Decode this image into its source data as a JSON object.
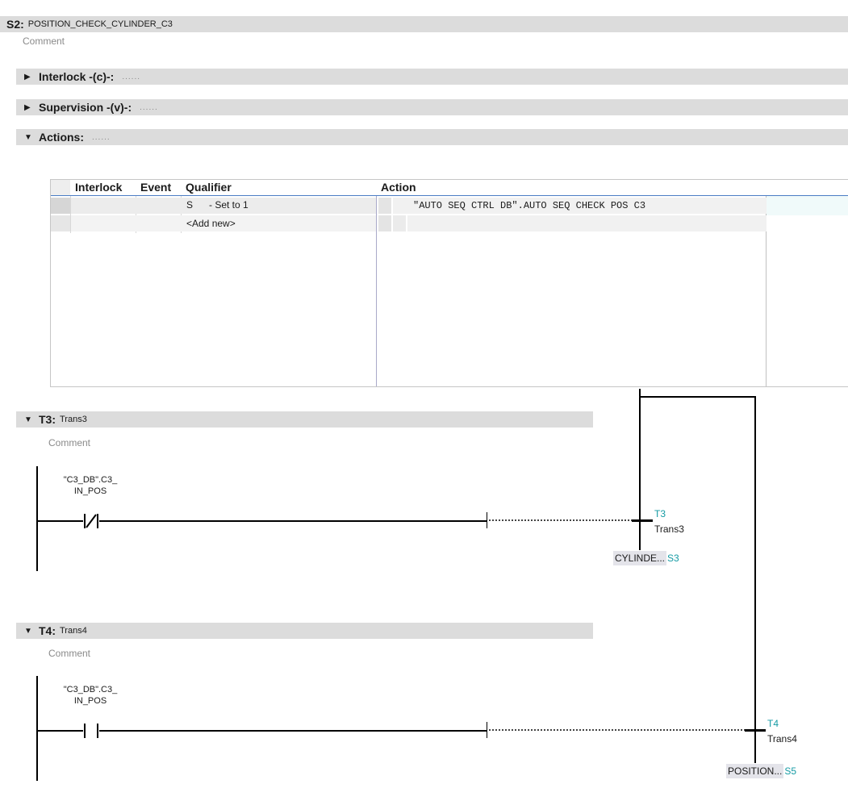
{
  "step": {
    "key": "S2:",
    "name": "POSITION_CHECK_CYLINDER_C3",
    "comment": "Comment"
  },
  "sections": {
    "interlock": {
      "label": "Interlock -(c)-:",
      "dots": "......"
    },
    "supervision": {
      "label": "Supervision -(v)-:",
      "dots": "......"
    },
    "actions": {
      "label": "Actions:",
      "dots": "......"
    }
  },
  "actions_table": {
    "headers": {
      "interlock": "Interlock",
      "event": "Event",
      "qualifier": "Qualifier",
      "action": "Action"
    },
    "rows": [
      {
        "qualifier": "S      - Set to 1",
        "action": "\"AUTO SEQ CTRL DB\".AUTO SEQ CHECK POS C3"
      },
      {
        "qualifier": "<Add new>",
        "action": ""
      }
    ]
  },
  "transitions": [
    {
      "key": "T3:",
      "name": "Trans3",
      "comment": "Comment",
      "var_line1": "\"C3_DB\".C3_",
      "var_line2": "IN_POS",
      "contact": "normally-closed",
      "label": "T3",
      "trans": "Trans3",
      "target": "CYLINDE...",
      "target_step": "S3"
    },
    {
      "key": "T4:",
      "name": "Trans4",
      "comment": "Comment",
      "var_line1": "\"C3_DB\".C3_",
      "var_line2": "IN_POS",
      "contact": "normally-open",
      "label": "T4",
      "trans": "Trans4",
      "target": "POSITION...",
      "target_step": "S5"
    }
  ],
  "colors": {
    "header_bg": "#dcdcdc",
    "accent_teal": "#159ba4",
    "table_header_line": "#4a7cc4"
  }
}
